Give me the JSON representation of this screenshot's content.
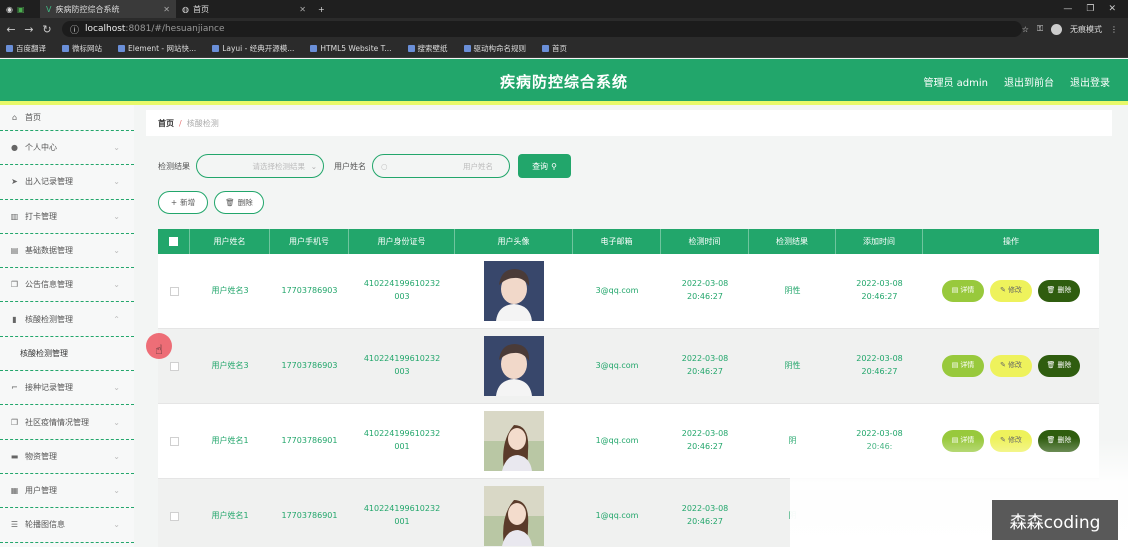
{
  "browser": {
    "tabs": [
      {
        "title": "疾病防控综合系统"
      },
      {
        "title": "首页"
      }
    ],
    "new_tab": "+",
    "url_host": "localhost",
    "url_path": ":8081/#/hesuanjiance",
    "profile_label": "无痕模式",
    "bookmarks": [
      "百度翻译",
      "微标网站",
      "Element - 网站快...",
      "Layui - 经典开源模...",
      "HTML5 Website T...",
      "搜索壁纸",
      "驱动构命名规则",
      "首页"
    ]
  },
  "header": {
    "title": "疾病防控综合系统",
    "admin_label": "管理员 admin",
    "back_label": "退出到前台",
    "logout_label": "退出登录"
  },
  "sidebar": {
    "items": [
      {
        "label": "首页",
        "icon": "home-icon",
        "glyph": "⌂"
      },
      {
        "label": "个人中心",
        "icon": "user-icon",
        "glyph": "●"
      },
      {
        "label": "出入记录管理",
        "icon": "send-icon",
        "glyph": "➤"
      },
      {
        "label": "打卡管理",
        "icon": "bank-icon",
        "glyph": "▥"
      },
      {
        "label": "基础数据管理",
        "icon": "clipboard-icon",
        "glyph": "▤"
      },
      {
        "label": "公告信息管理",
        "icon": "copy-icon",
        "glyph": "❐"
      },
      {
        "label": "核酸检测管理",
        "icon": "chart-icon",
        "glyph": "▮"
      },
      {
        "label": "核酸检测管理",
        "icon": "",
        "glyph": ""
      },
      {
        "label": "接种记录管理",
        "icon": "crop-icon",
        "glyph": "⌐"
      },
      {
        "label": "社区疫情情况管理",
        "icon": "copy-icon",
        "glyph": "❐"
      },
      {
        "label": "物资管理",
        "icon": "drawer-icon",
        "glyph": "▬"
      },
      {
        "label": "用户管理",
        "icon": "calendar-icon",
        "glyph": "▦"
      },
      {
        "label": "轮播图信息",
        "icon": "sliders-icon",
        "glyph": "☰"
      }
    ]
  },
  "breadcrumb": {
    "home": "首页",
    "sep": "/",
    "current": "核酸检测"
  },
  "filters": {
    "result_label": "检测结果",
    "result_placeholder": "请选择检测结果",
    "name_label": "用户姓名",
    "name_placeholder": "用户姓名",
    "search_button": "查询"
  },
  "actions": {
    "add": "新增",
    "delete": "删除"
  },
  "table": {
    "headers": [
      "用户姓名",
      "用户手机号",
      "用户身份证号",
      "用户头像",
      "电子邮箱",
      "检测时间",
      "检测结果",
      "添加时间",
      "操作"
    ],
    "rows": [
      {
        "name": "用户姓名3",
        "phone": "17703786903",
        "id_number": "410224199610232003",
        "avatar": "male",
        "email": "3@qq.com",
        "test_time": "2022-03-08 20:46:27",
        "result": "阴性",
        "added": "2022-03-08 20:46:27"
      },
      {
        "name": "用户姓名3",
        "phone": "17703786903",
        "id_number": "410224199610232003",
        "avatar": "male",
        "email": "3@qq.com",
        "test_time": "2022-03-08 20:46:27",
        "result": "阴性",
        "added": "2022-03-08 20:46:27"
      },
      {
        "name": "用户姓名1",
        "phone": "17703786901",
        "id_number": "410224199610232001",
        "avatar": "female",
        "email": "1@qq.com",
        "test_time": "2022-03-08 20:46:27",
        "result": "阴",
        "added": "2022-03-08 20:46:"
      },
      {
        "name": "用户姓名1",
        "phone": "17703786901",
        "id_number": "410224199610232001",
        "avatar": "female",
        "email": "1@qq.com",
        "test_time": "2022-03-08 20:46:27",
        "result": "阴",
        "added": ""
      }
    ],
    "ops": {
      "detail": "详情",
      "edit": "修改",
      "delete": "删除"
    }
  },
  "watermark": "森森coding",
  "colors": {
    "primary": "#22a66b",
    "accent_stripe": "#e8f96a",
    "detail": "#98c93c",
    "edit": "#eef25c",
    "delete": "#2f5d0f"
  }
}
